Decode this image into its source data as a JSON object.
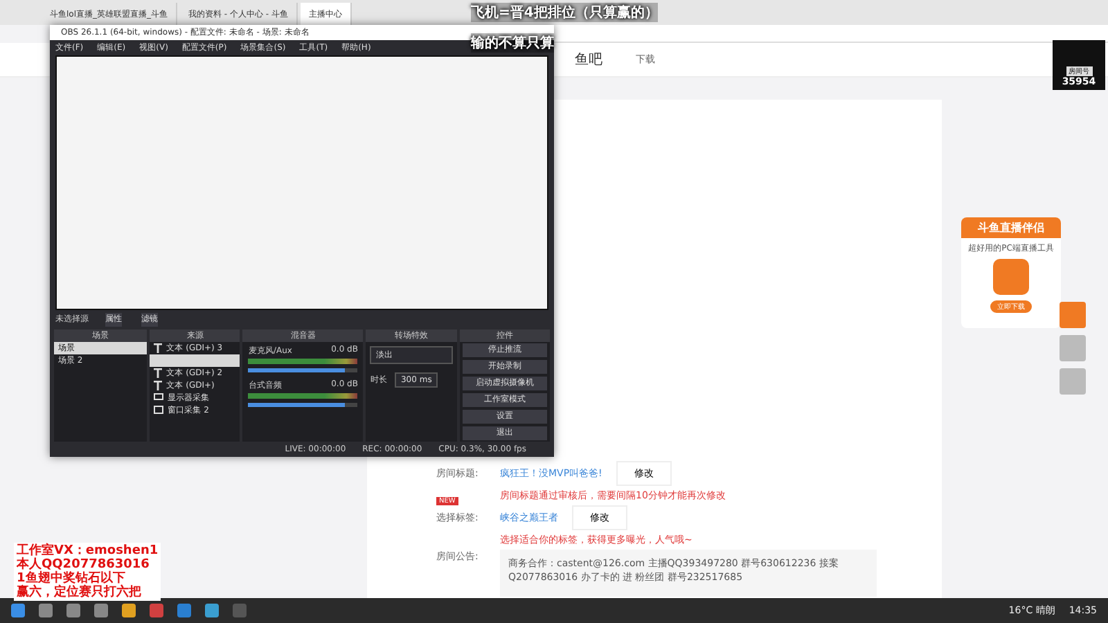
{
  "browser": {
    "tabs": [
      {
        "title": "斗鱼lol直播_英雄联盟直播_斗鱼",
        "selected": false
      },
      {
        "title": "我的资料 - 个人中心 - 斗鱼",
        "selected": false
      },
      {
        "title": "主播中心",
        "selected": true
      }
    ]
  },
  "site_header": {
    "nav": "鱼吧",
    "download": "下载"
  },
  "obs": {
    "title": "OBS 26.1.1 (64-bit, windows) - 配置文件: 未命名 - 场景: 未命名",
    "menu": [
      "文件(F)",
      "编辑(E)",
      "视图(V)",
      "配置文件(P)",
      "场景集合(S)",
      "工具(T)",
      "帮助(H)"
    ],
    "source_bar": {
      "label": "未选择源",
      "properties": "属性",
      "filters": "滤镜"
    },
    "docks": {
      "scenes": "场景",
      "sources": "来源",
      "mixer": "混音器",
      "transitions": "转场特效",
      "controls": "控件"
    },
    "scenes": [
      {
        "name": "场景",
        "selected": true
      },
      {
        "name": "场景 2",
        "selected": false
      }
    ],
    "sources": [
      {
        "name": "文本 (GDI+) 3",
        "kind": "text",
        "selected": false
      },
      {
        "kind": "blank",
        "selected": true
      },
      {
        "name": "文本 (GDI+) 2",
        "kind": "text",
        "selected": false
      },
      {
        "name": "文本 (GDI+)",
        "kind": "text",
        "selected": false
      },
      {
        "name": "显示器采集",
        "kind": "monitor",
        "selected": false
      },
      {
        "name": "窗口采集 2",
        "kind": "window",
        "selected": false
      }
    ],
    "mixer": [
      {
        "name": "麦克风/Aux",
        "reading": "0.0 dB",
        "level": 0.88
      },
      {
        "name": "台式音频",
        "reading": "0.0 dB",
        "level": 0.88
      }
    ],
    "transition": {
      "value": "淡出",
      "duration_label": "时长",
      "duration": "300 ms"
    },
    "controls": [
      "停止推流",
      "开始录制",
      "启动虚拟摄像机",
      "工作室模式",
      "设置",
      "退出"
    ],
    "status": {
      "live": "LIVE: 00:00:00",
      "rec": "REC: 00:00:00",
      "cpu": "CPU: 0.3%, 30.00 fps"
    }
  },
  "room": {
    "rows": [
      {
        "label": "房间标题:",
        "value": "疯狂王！没MVP叫爸爸!",
        "action": "修改",
        "note": "房间标题通过审核后，需要间隔10分钟才能再次修改"
      },
      {
        "label": "选择标签:",
        "badge": "NEW",
        "value": "峡谷之巅王者",
        "action": "修改",
        "note": "选择适合你的标签，获得更多曝光，人气哦~"
      }
    ],
    "notice_label": "房间公告:",
    "notice": "商务合作：castent@126.com 主播QQ393497280 群号630612236 接案Q2077863016 办了卡的 进 粉丝团 群号232517685"
  },
  "ad": {
    "title": "斗鱼直播伴侣",
    "subtitle": "超好用的PC端直播工具",
    "button": "立即下载"
  },
  "room_badge": {
    "label": "房间号",
    "number": "35954"
  },
  "overlay": {
    "top": [
      "飞机=晋4把排位（只算赢的）",
      "输的不算只算"
    ],
    "bottom": [
      "工作室VX：emoshen1",
      "本人QQ2077863016",
      "1鱼翅中奖钻石以下",
      "赢六，定位赛只打六把"
    ]
  },
  "taskbar": {
    "weather": "16°C 晴朗",
    "time": "14:35"
  }
}
